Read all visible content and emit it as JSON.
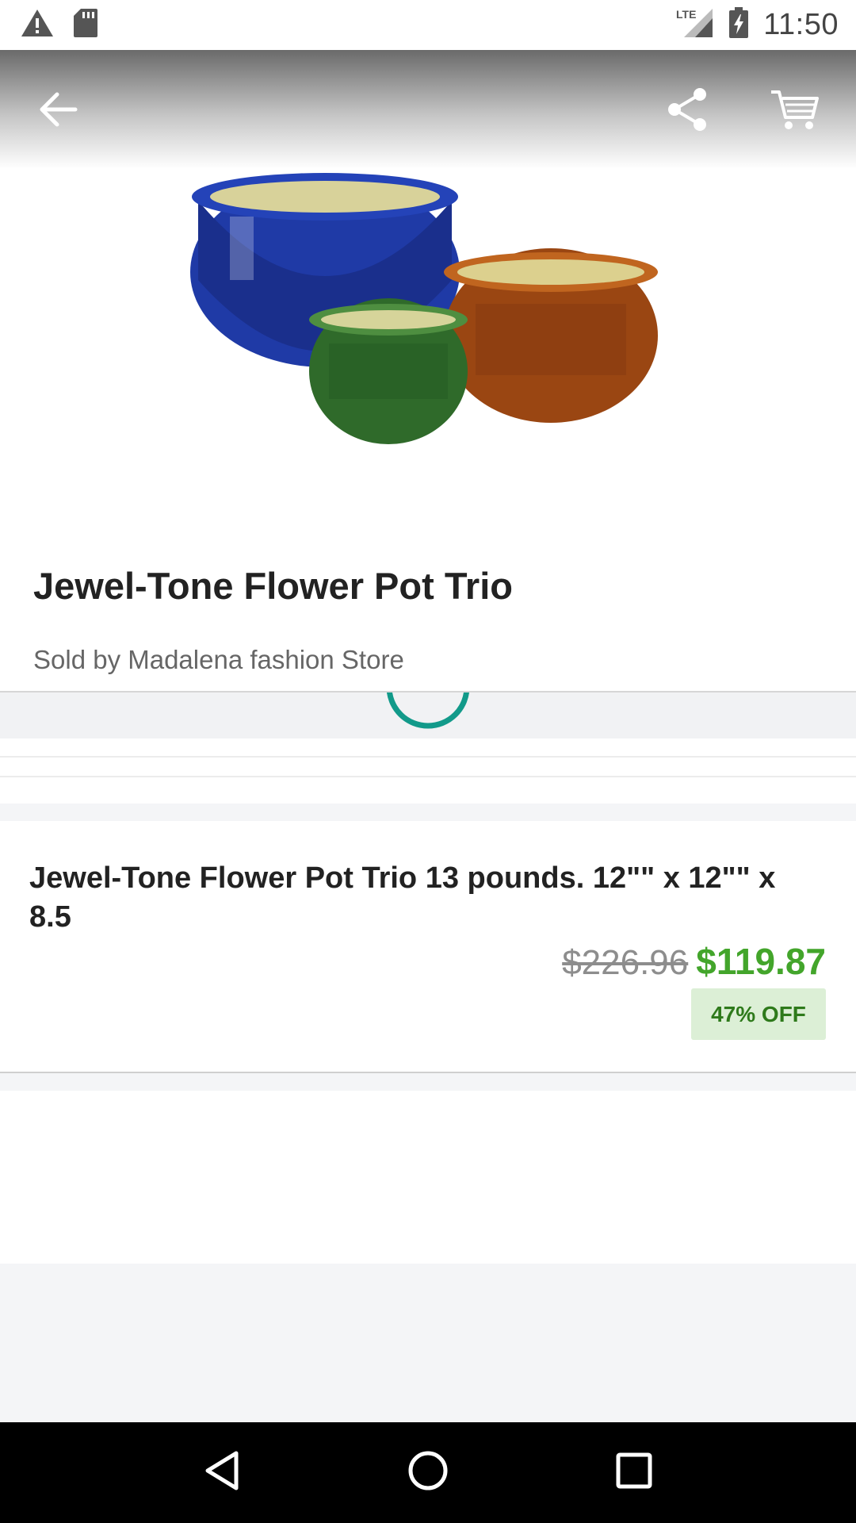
{
  "status_bar": {
    "time": "11:50",
    "network": "LTE",
    "icons": [
      "warning-icon",
      "sd-card-icon",
      "lte-signal-icon",
      "battery-charging-icon"
    ]
  },
  "toolbar": {
    "icons": [
      "back-arrow-icon",
      "share-icon",
      "shopping-cart-icon"
    ]
  },
  "product": {
    "title": "Jewel-Tone Flower Pot Trio",
    "seller": "Sold by Madalena fashion Store",
    "description": "Jewel-Tone Flower Pot Trio 13 pounds. 12\"\" x 12\"\" x 8.5",
    "original_price": "$226.96",
    "sale_price": "$119.87",
    "discount": "47% OFF"
  },
  "colors": {
    "sale_price": "#43a52b",
    "discount_bg": "#dcefd6",
    "discount_text": "#2e7a1b",
    "spinner": "#129a8a"
  },
  "nav_bar": {
    "icons": [
      "nav-back-icon",
      "nav-home-icon",
      "nav-recents-icon"
    ]
  }
}
